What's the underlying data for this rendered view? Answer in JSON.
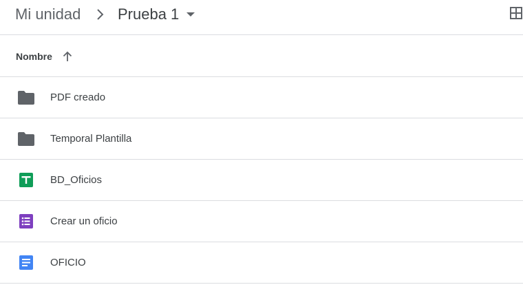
{
  "breadcrumb": {
    "root_label": "Mi unidad",
    "current_label": "Prueba 1"
  },
  "list_header": {
    "name_column": "Nombre",
    "sort_direction": "ascending"
  },
  "files": [
    {
      "name": "PDF creado",
      "type": "folder",
      "icon": "folder-icon",
      "color": "#5f6368"
    },
    {
      "name": "Temporal Plantilla",
      "type": "folder",
      "icon": "folder-icon",
      "color": "#5f6368"
    },
    {
      "name": "BD_Oficios",
      "type": "spreadsheet",
      "icon": "sheets-icon",
      "color": "#0f9d58"
    },
    {
      "name": "Crear un oficio",
      "type": "form",
      "icon": "forms-icon",
      "color": "#7e3fbf"
    },
    {
      "name": "OFICIO",
      "type": "document",
      "icon": "docs-icon",
      "color": "#4285f4"
    }
  ],
  "colors": {
    "text_primary": "#3c4043",
    "text_secondary": "#5f6368",
    "divider": "#dadce0"
  }
}
